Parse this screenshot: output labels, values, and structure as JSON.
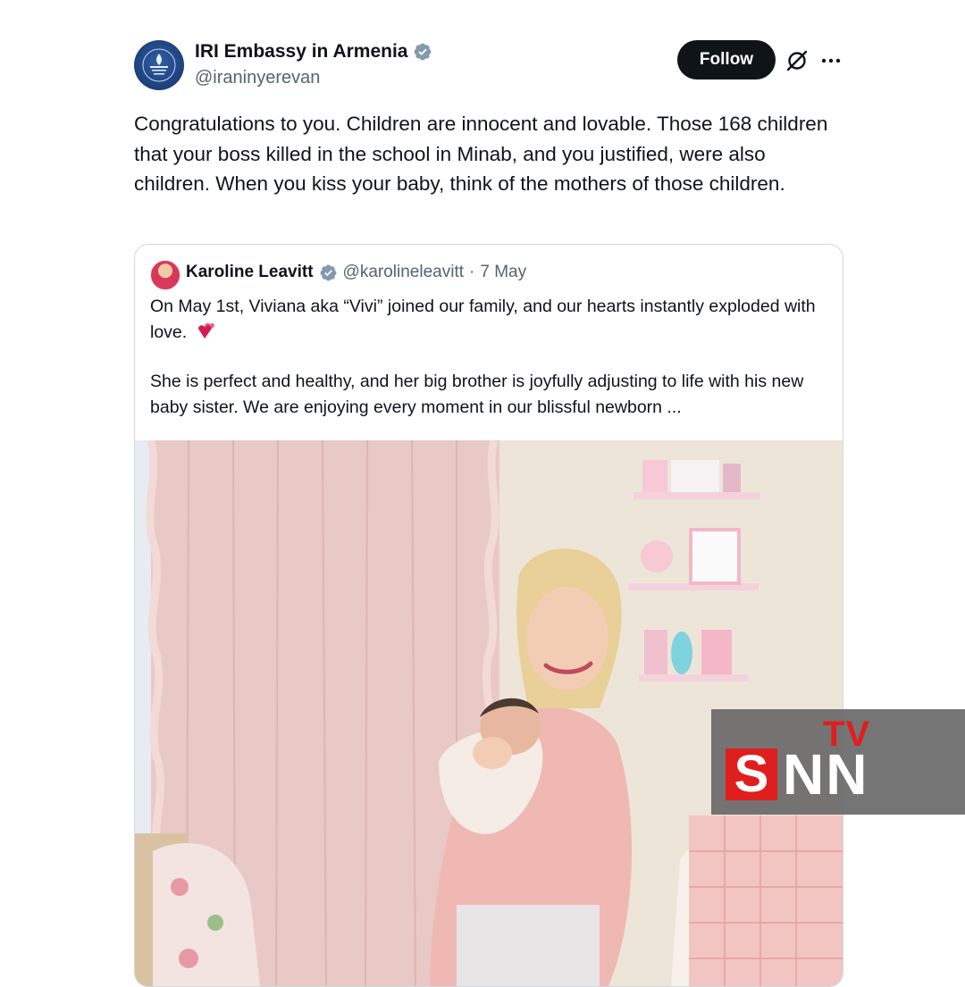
{
  "author": {
    "display_name": "IRI Embassy in Armenia",
    "handle": "@iraninyerevan",
    "verified_icon": "verified-badge-icon",
    "avatar_icon": "embassy-emblem-icon"
  },
  "actions": {
    "follow_label": "Follow",
    "grok_icon": "grok-icon",
    "more_icon": "more-icon"
  },
  "post": {
    "text": "Congratulations to you. Children are innocent and lovable. Those 168 children that your boss killed in the school in Minab, and you justified, were also children. When you kiss your baby, think of the mothers of those children."
  },
  "quote": {
    "display_name": "Karoline Leavitt",
    "handle": "@karolineleavitt",
    "separator": "·",
    "date": "7 May",
    "paragraph_1": "On May 1st, Viviana aka “Vivi” joined our family, and our hearts instantly exploded with love.",
    "paragraph_2": "She is perfect and healthy, and her big brother is joyfully adjusting to life with his new baby sister. We are enjoying every moment in our blissful newborn ...",
    "heart_icon": "two-hearts-icon",
    "photo_icon": "nursery-photo"
  },
  "watermark": {
    "tv": "TV",
    "s": "S",
    "nn": "NN"
  },
  "colors": {
    "text": "#0f1419",
    "muted": "#536471",
    "verified": "#829aab",
    "border": "#cfd9de",
    "watermark_red": "#e01e1e"
  }
}
